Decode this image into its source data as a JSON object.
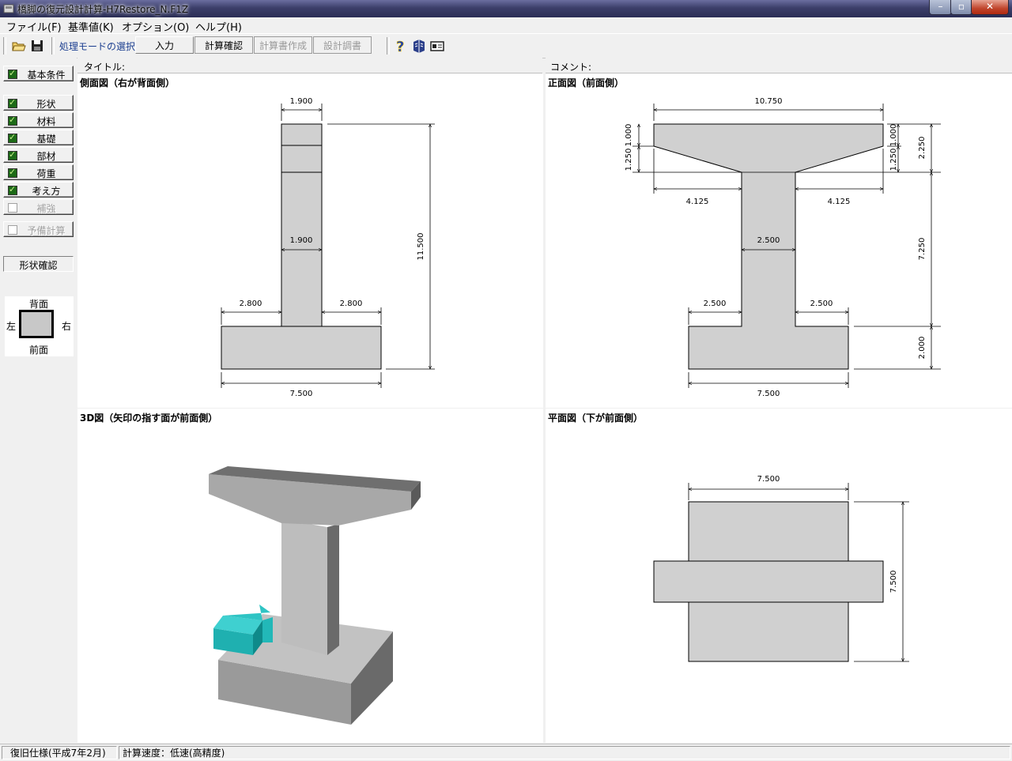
{
  "window": {
    "title": "橋脚の復元設計計算-H7Restore_N.F1Z"
  },
  "menu": [
    "ファイル(F)",
    "基準値(K)",
    "オプション(O)",
    "ヘルプ(H)"
  ],
  "toolbar": {
    "mode_label": "処理モードの選択",
    "modes": [
      {
        "label": "入力",
        "state": "active"
      },
      {
        "label": "計算確認",
        "state": "enabled"
      },
      {
        "label": "計算書作成",
        "state": "disabled"
      },
      {
        "label": "設計調書",
        "state": "disabled"
      }
    ]
  },
  "sidebar": {
    "basic": "基本条件",
    "items": [
      {
        "label": "形状",
        "checked": true
      },
      {
        "label": "材料",
        "checked": true
      },
      {
        "label": "基礎",
        "checked": true
      },
      {
        "label": "部材",
        "checked": true
      },
      {
        "label": "荷重",
        "checked": true
      },
      {
        "label": "考え方",
        "checked": true
      },
      {
        "label": "補強",
        "checked": false
      }
    ],
    "preliminary": "予備計算",
    "confirm": "形状確認",
    "orientation": {
      "back": "背面",
      "left": "左",
      "right": "右",
      "front": "前面"
    }
  },
  "headers": {
    "title_label": "タイトル:",
    "comment_label": "コメント:"
  },
  "views": {
    "side": {
      "title": "側面図（右が背面側）",
      "dims": {
        "top_width": "1.900",
        "column_width": "1.900",
        "left_footing": "2.800",
        "right_footing": "2.800",
        "footing_width": "7.500",
        "height": "11.500"
      }
    },
    "front": {
      "title": "正面図（前面側）",
      "dims": {
        "beam_width": "10.750",
        "cant_left": "4.125",
        "cant_right": "4.125",
        "column_width": "2.500",
        "left_footing": "2.500",
        "right_footing": "2.500",
        "footing_width": "7.500",
        "beam_depth_a": "1.000",
        "beam_depth_b": "1.250",
        "beam_depth_c": "1.000",
        "beam_depth_d": "1.250",
        "beam_total": "2.250",
        "column_height": "7.250",
        "footing_height": "2.000"
      }
    },
    "iso": {
      "title": "3D図（矢印の指す面が前面側）"
    },
    "plan": {
      "title": "平面図（下が前面側）",
      "dims": {
        "width": "7.500",
        "depth": "7.500"
      }
    }
  },
  "status": {
    "spec": "復旧仕様(平成7年2月)",
    "speed": "計算速度：低速(高精度)"
  }
}
